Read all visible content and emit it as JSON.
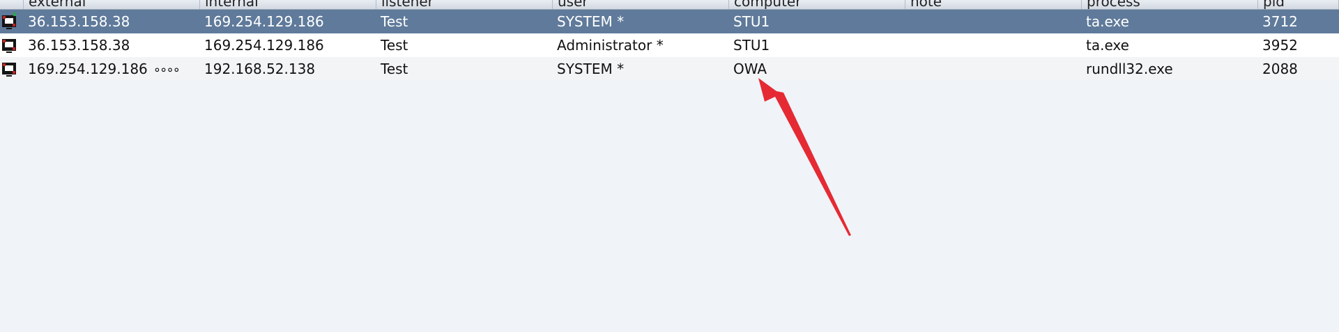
{
  "columns": {
    "external": "external",
    "internal": "internal",
    "listener": "listener",
    "user": "user",
    "computer": "computer",
    "note": "note",
    "process": "process",
    "pid": "pid"
  },
  "rows": [
    {
      "icon": "session-icon",
      "external": "36.153.158.38",
      "internal": "169.254.129.186",
      "listener": "Test",
      "user": "SYSTEM *",
      "computer": "STU1",
      "note": "",
      "process": "ta.exe",
      "pid": "3712",
      "selected": true
    },
    {
      "icon": "session-icon",
      "external": "36.153.158.38",
      "internal": "169.254.129.186",
      "listener": "Test",
      "user": "Administrator *",
      "computer": "STU1",
      "note": "",
      "process": "ta.exe",
      "pid": "3952",
      "selected": false
    },
    {
      "icon": "session-icon",
      "external": "169.254.129.186",
      "link_indicator": "∘∘∘∘",
      "internal": "192.168.52.138",
      "listener": "Test",
      "user": "SYSTEM *",
      "computer": "OWA",
      "note": "",
      "process": "rundll32.exe",
      "pid": "2088",
      "selected": false
    }
  ],
  "colors": {
    "selected_row": "#5f7a9a",
    "annotation_arrow": "#e52a33",
    "background": "#f0f3f8"
  }
}
